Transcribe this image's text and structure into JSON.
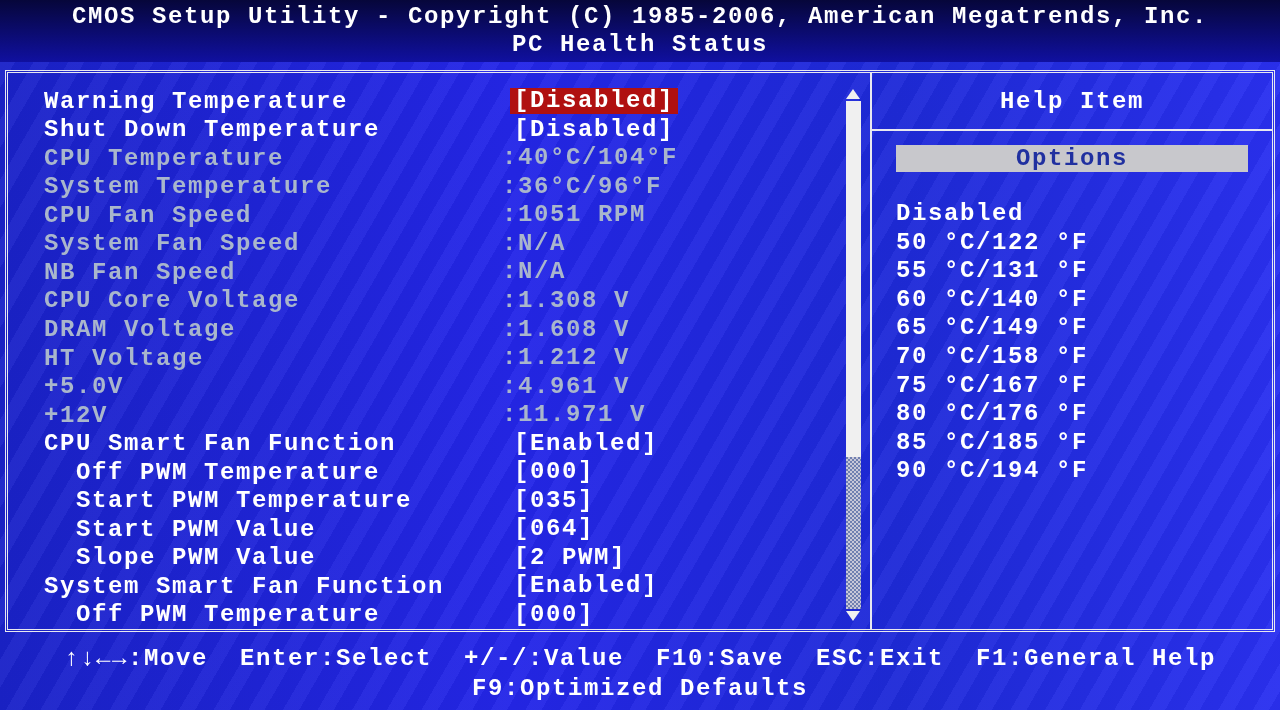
{
  "header": {
    "title": "CMOS Setup Utility - Copyright (C) 1985-2006, American Megatrends, Inc.",
    "subtitle": "PC Health Status"
  },
  "settings": [
    {
      "label": "Warning Temperature",
      "value": "[Disabled]",
      "kind": "setting",
      "selected": true
    },
    {
      "label": "Shut Down Temperature",
      "value": "[Disabled]",
      "kind": "setting",
      "selected": false
    },
    {
      "label": "CPU Temperature",
      "value": ":40°C/104°F",
      "kind": "reading"
    },
    {
      "label": "System Temperature",
      "value": ":36°C/96°F",
      "kind": "reading"
    },
    {
      "label": "CPU Fan Speed",
      "value": ":1051 RPM",
      "kind": "reading"
    },
    {
      "label": "System Fan Speed",
      "value": ":N/A",
      "kind": "reading"
    },
    {
      "label": "NB Fan Speed",
      "value": ":N/A",
      "kind": "reading"
    },
    {
      "label": "CPU Core Voltage",
      "value": ":1.308 V",
      "kind": "reading"
    },
    {
      "label": "DRAM Voltage",
      "value": ":1.608 V",
      "kind": "reading"
    },
    {
      "label": "HT Voltage",
      "value": ":1.212 V",
      "kind": "reading"
    },
    {
      "label": "+5.0V",
      "value": ":4.961 V",
      "kind": "reading"
    },
    {
      "label": "+12V",
      "value": ":11.971 V",
      "kind": "reading"
    },
    {
      "label": "CPU Smart Fan Function",
      "value": "[Enabled]",
      "kind": "setting",
      "selected": false,
      "children": [
        {
          "label": "Off PWM Temperature",
          "value": "[000]",
          "kind": "setting",
          "selected": false
        },
        {
          "label": "Start PWM Temperature",
          "value": "[035]",
          "kind": "setting",
          "selected": false
        },
        {
          "label": "Start PWM Value",
          "value": "[064]",
          "kind": "setting",
          "selected": false
        },
        {
          "label": "Slope PWM Value",
          "value": "[2 PWM]",
          "kind": "setting",
          "selected": false
        }
      ]
    },
    {
      "label": "System Smart Fan Function",
      "value": "[Enabled]",
      "kind": "setting",
      "selected": false,
      "children": [
        {
          "label": "Off PWM Temperature",
          "value": "[000]",
          "kind": "setting",
          "selected": false
        }
      ]
    }
  ],
  "help": {
    "title": "Help Item",
    "options_heading": "Options",
    "options": [
      "Disabled",
      "50 °C/122 °F",
      "55 °C/131 °F",
      "60 °C/140 °F",
      "65 °C/149 °F",
      "70 °C/158 °F",
      "75 °C/167 °F",
      "80 °C/176 °F",
      "85 °C/185 °F",
      "90 °C/194 °F"
    ]
  },
  "footer": {
    "lines": [
      [
        "↑↓←→:Move",
        "Enter:Select",
        "+/-/:Value",
        "F10:Save",
        "ESC:Exit",
        "F1:General Help"
      ],
      [
        "F9:Optimized Defaults"
      ]
    ]
  }
}
